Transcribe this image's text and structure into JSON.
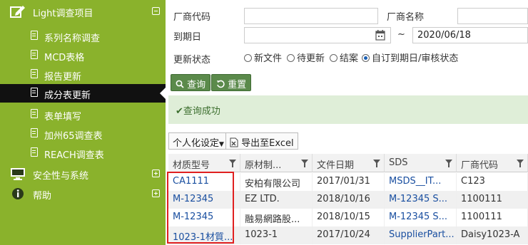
{
  "sidebar": {
    "project_section": {
      "label": "Light调查项目"
    },
    "items": [
      {
        "label": "系列名称调查"
      },
      {
        "label": "MCD表格"
      },
      {
        "label": "报告更新"
      },
      {
        "label": "成分表更新"
      },
      {
        "label": "表单填写"
      },
      {
        "label": "加州65调查表"
      },
      {
        "label": "REACH调查表"
      }
    ],
    "security_section": {
      "label": "安全性与系统"
    },
    "help_section": {
      "label": "帮助"
    }
  },
  "form": {
    "vendor_code_label": "厂商代码",
    "vendor_code_value": "",
    "vendor_name_label": "厂商名称",
    "vendor_name_value": "",
    "due_date_label": "到期日",
    "due_date_from": "",
    "date_sep": "~",
    "due_date_to": "2020/06/18",
    "status_label": "更新状态",
    "status_options": [
      "新文件",
      "待更新",
      "结案",
      "自订到期日/审核状态"
    ],
    "status_selected": 3
  },
  "buttons": {
    "query": "查询",
    "reset": "重置"
  },
  "alert": {
    "message": "查询成功"
  },
  "toolbar": {
    "personalize": "个人化设定",
    "export": "导出至Excel"
  },
  "table": {
    "columns": [
      "材质型号",
      "原材制...",
      "文件日期",
      "SDS",
      "厂商代码"
    ],
    "rows": [
      [
        "CA1111",
        "安柏有限公司",
        "2017/01/31",
        "MSDS__IT...",
        "C123"
      ],
      [
        "M-12345",
        "EZ LTD.",
        "2018/10/16",
        "M-12345 S...",
        "1100111"
      ],
      [
        "M-12345",
        "融易網路股...",
        "2018/10/15",
        "M-12345 S...",
        "1100111"
      ],
      [
        "1023-1材質...",
        "1023-1",
        "2017/10/24",
        "SupplierPart...",
        "Daisy1023-A"
      ]
    ]
  },
  "colors": {
    "sidebar_bg": "#8ab22c",
    "active_item_bg": "#111111",
    "button_bg": "#5b8a4b",
    "alert_bg": "#dfeed8",
    "link": "#1a4fa0",
    "highlight": "#e02020"
  }
}
